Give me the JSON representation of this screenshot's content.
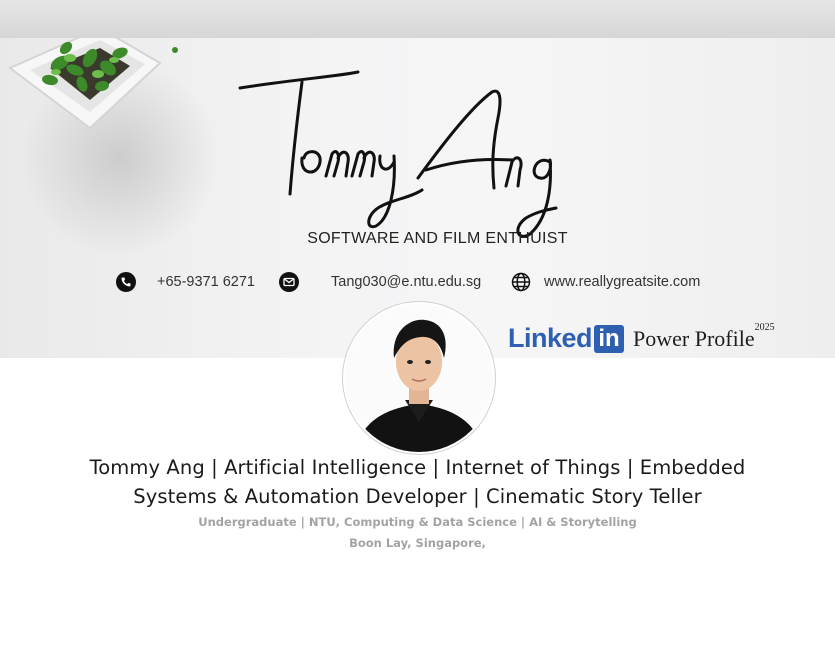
{
  "banner": {
    "signature_name": "Tommy Ang",
    "tagline": "SOFTWARE AND FILM ENTHUIST",
    "phone": "+65-9371 6271",
    "email": "Tang030@e.ntu.edu.sg",
    "website": "www.reallygreatsite.com",
    "badge": {
      "brand_word": "Linked",
      "brand_box": "in",
      "label": "Power Profile",
      "year": "2025"
    }
  },
  "profile": {
    "headline_line1": "Tommy Ang | Artificial Intelligence | Internet of Things | Embedded",
    "headline_line2": "Systems & Automation Developer | Cinematic Story Teller",
    "education": "Undergraduate | NTU, Computing & Data Science | AI & Storytelling",
    "location": "Boon Lay, Singapore,"
  },
  "icons": {
    "phone": "phone-icon",
    "email": "mail-icon",
    "website": "globe-icon"
  },
  "colors": {
    "linkedin_blue": "#2e5fb0",
    "subtext_gray": "#a3a3a3"
  }
}
